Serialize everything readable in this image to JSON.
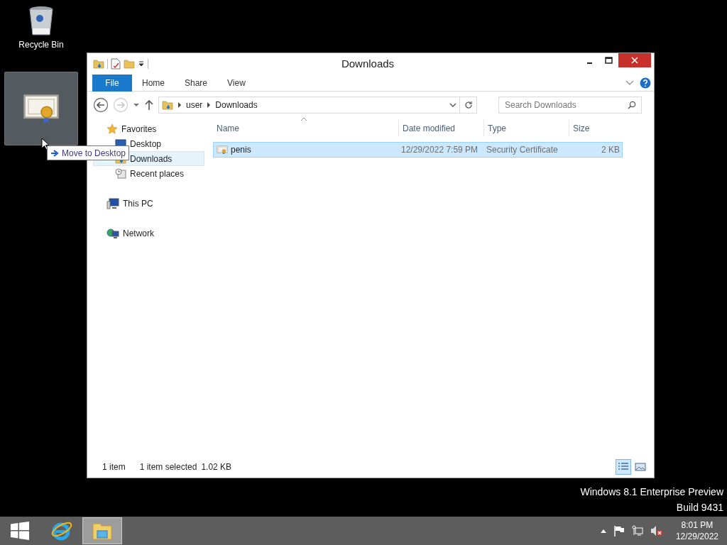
{
  "desktop": {
    "icons": [
      {
        "kind": "recycle-bin",
        "label": "Recycle Bin",
        "selected": false
      },
      {
        "kind": "certificate",
        "selected": true
      }
    ],
    "drag_tooltip": "Move to Desktop"
  },
  "window": {
    "title": "Downloads",
    "ribbon_tabs": [
      {
        "kind": "file",
        "label": "File"
      },
      {
        "kind": "tab",
        "label": "Home"
      },
      {
        "kind": "tab",
        "label": "Share"
      },
      {
        "kind": "tab",
        "label": "View"
      }
    ],
    "address": {
      "segments": [
        "user",
        "Downloads"
      ]
    },
    "search": {
      "placeholder": "Search Downloads"
    },
    "nav": [
      {
        "kind": "star",
        "label": "Favorites",
        "selected": false,
        "children": [
          {
            "kind": "desktop",
            "label": "Desktop",
            "selected": false
          },
          {
            "kind": "downloads",
            "label": "Downloads",
            "selected": true
          },
          {
            "kind": "recent",
            "label": "Recent places",
            "selected": false
          }
        ]
      },
      {
        "kind": "pc",
        "label": "This PC",
        "selected": false
      },
      {
        "kind": "network",
        "label": "Network",
        "selected": false
      }
    ],
    "columns": [
      "Name",
      "Date modified",
      "Type",
      "Size"
    ],
    "rows": [
      {
        "name": "penis",
        "date": "12/29/2022 7:59 PM",
        "type": "Security Certificate",
        "size": "2 KB",
        "selected": true
      }
    ],
    "status": {
      "count": "1 item",
      "selection": "1 item selected",
      "size": "1.02 KB"
    },
    "view_buttons": [
      {
        "kind": "details",
        "selected": true
      },
      {
        "kind": "thumbnails",
        "selected": false
      }
    ]
  },
  "os_build": {
    "edition": "Windows 8.1 Enterprise Preview",
    "build": "Build 9431"
  },
  "taskbar": {
    "apps": [
      {
        "kind": "start",
        "selected": false
      },
      {
        "kind": "browser",
        "selected": false
      },
      {
        "kind": "explorer",
        "selected": true
      }
    ],
    "clock": {
      "time": "8:01 PM",
      "date": "12/29/2022"
    }
  }
}
